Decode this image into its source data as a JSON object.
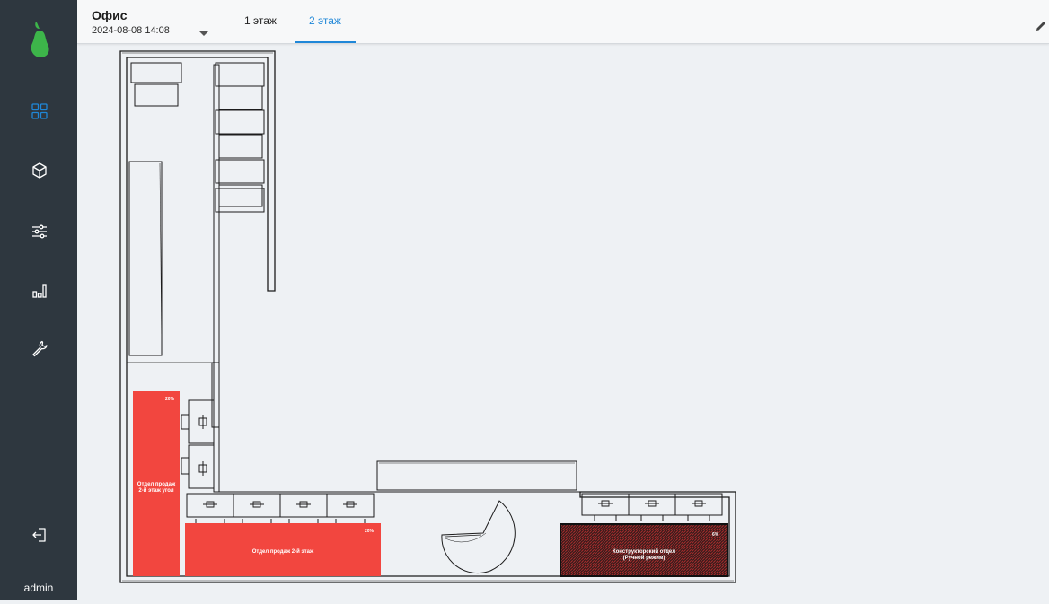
{
  "sidebar": {
    "logo_icon": "pear-logo",
    "nav": [
      {
        "icon": "grid-dashboard-icon",
        "active": true
      },
      {
        "icon": "cube-icon"
      },
      {
        "icon": "sliders-icon"
      },
      {
        "icon": "bar-chart-icon"
      },
      {
        "icon": "wrench-icon"
      }
    ],
    "logout_icon": "logout-icon",
    "user": "admin"
  },
  "header": {
    "location_title": "Офис",
    "timestamp": "2024-08-08 14:08",
    "tabs": [
      {
        "label": "1 этаж",
        "active": false
      },
      {
        "label": "2 этаж",
        "active": true
      }
    ],
    "edit_icon": "pencil-icon"
  },
  "rooms": [
    {
      "name_line1": "Отдел продаж",
      "name_line2": "2-й этаж угол",
      "percent": "20%",
      "color": "#f2463f"
    },
    {
      "name_line1": "Отдел продаж 2-й этаж",
      "name_line2": "",
      "percent": "20%",
      "color": "#f2463f"
    },
    {
      "name_line1": "Конструкторский отдел",
      "name_line2": "(Ручной режим)",
      "percent": "6%",
      "color": "#8b1a1a"
    }
  ],
  "colors": {
    "sidebar_bg": "#2e373f",
    "accent": "#1f87d8",
    "logo_green": "#3db54a",
    "room_red": "#f2463f",
    "room_dark_red": "#8b1a1a"
  }
}
